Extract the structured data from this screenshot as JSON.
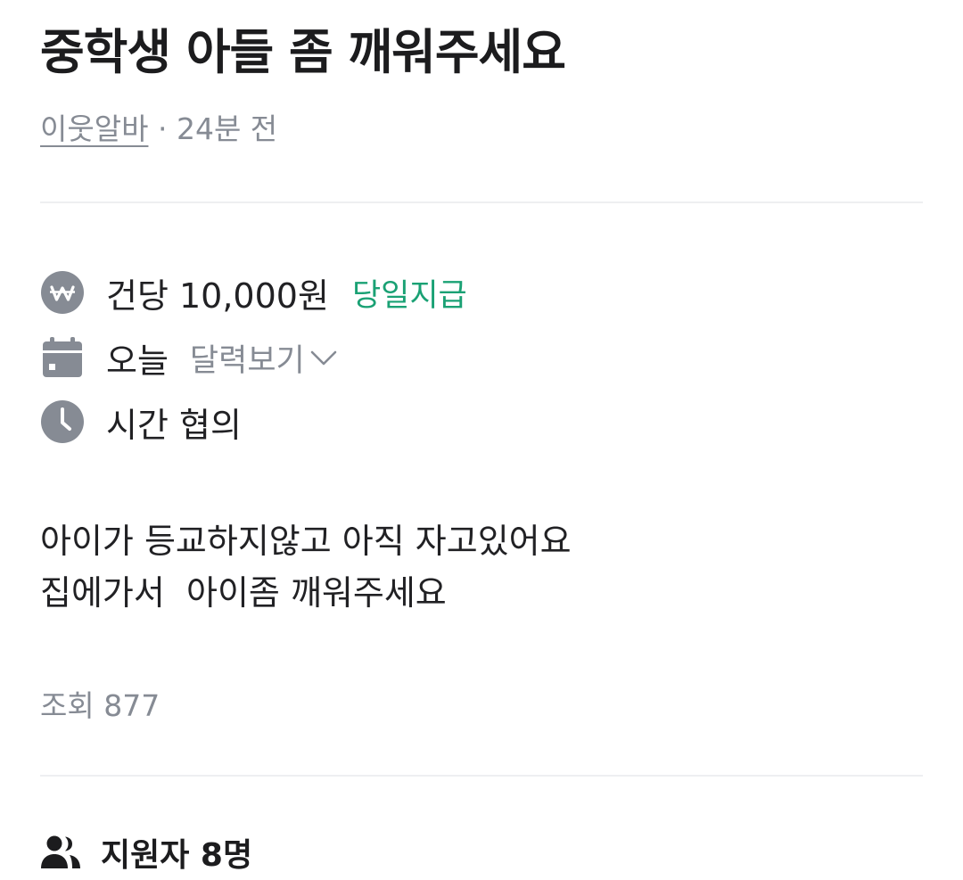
{
  "post": {
    "title": "중학생 아들 좀 깨워주세요",
    "author": "이웃알바",
    "separator": "·",
    "time_ago": "24분 전"
  },
  "details": {
    "pay": {
      "icon": "won-icon",
      "text": "건당 10,000원",
      "badge": "당일지급"
    },
    "date": {
      "icon": "calendar-icon",
      "text": "오늘",
      "link": "달력보기"
    },
    "time": {
      "icon": "clock-icon",
      "text": "시간 협의"
    }
  },
  "description": {
    "line1": "아이가 등교하지않고 아직 자고있어요",
    "line2": "집에가서  아이좀 깨워주세요"
  },
  "views": "조회 877",
  "applicants": {
    "icon": "people-icon",
    "label": "지원자 8명"
  },
  "colors": {
    "title": "#1c1c1e",
    "secondary_text": "#868b94",
    "accent_green": "#1aa174",
    "icon_gray": "#868b94",
    "divider": "#eeeff1"
  }
}
